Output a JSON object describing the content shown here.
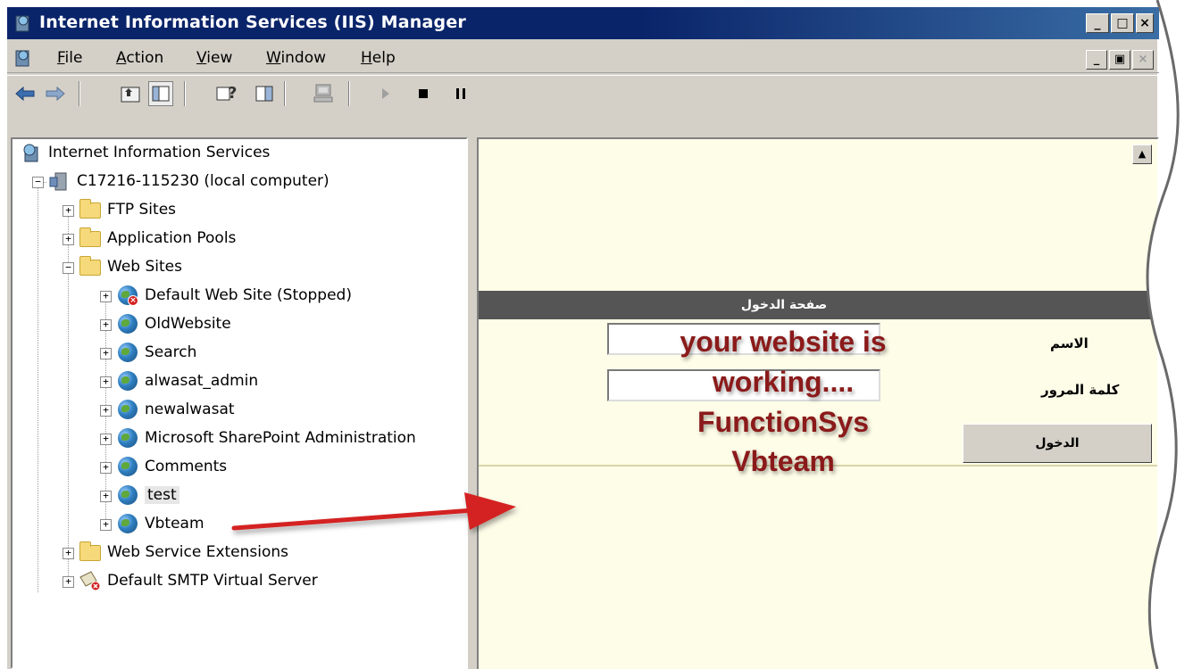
{
  "window": {
    "title": "Internet Information Services (IIS) Manager"
  },
  "menu": {
    "items": [
      {
        "accel": "F",
        "rest": "ile"
      },
      {
        "accel": "A",
        "rest": "ction"
      },
      {
        "accel": "V",
        "rest": "iew"
      },
      {
        "accel": "W",
        "rest": "indow"
      },
      {
        "accel": "H",
        "rest": "elp"
      }
    ]
  },
  "toolbar": {
    "icons": [
      "back-arrow-icon",
      "forward-arrow-icon",
      "up-folder-icon",
      "show-hide-tree-icon",
      "help-icon",
      "action-pane-icon",
      "computer-icon",
      "play-icon",
      "stop-icon",
      "pause-icon"
    ]
  },
  "tree": {
    "root": "Internet Information Services",
    "computer": "C17216-115230 (local computer)",
    "folders": {
      "ftp": "FTP Sites",
      "pools": "Application Pools",
      "websites": "Web Sites",
      "extensions": "Web Service Extensions"
    },
    "sites": [
      "Default Web Site (Stopped)",
      "OldWebsite",
      "Search",
      "alwasat_admin",
      "newalwasat",
      "Microsoft SharePoint Administration",
      "Comments",
      "test",
      "Vbteam"
    ],
    "smtp": "Default SMTP Virtual Server"
  },
  "login": {
    "header": "صفحة الدخول",
    "name_label": "الاسم",
    "password_label": "كلمة المرور",
    "button": "الدخول"
  },
  "overlay": {
    "line1": "your website is",
    "line2": "working....",
    "line3": "FunctionSys",
    "line4": "Vbteam"
  },
  "colors": {
    "titlebar": "#0a246a",
    "overlay_text": "#8b1a1a",
    "arrow": "#d42020",
    "pane_bg": "#fefde8"
  }
}
